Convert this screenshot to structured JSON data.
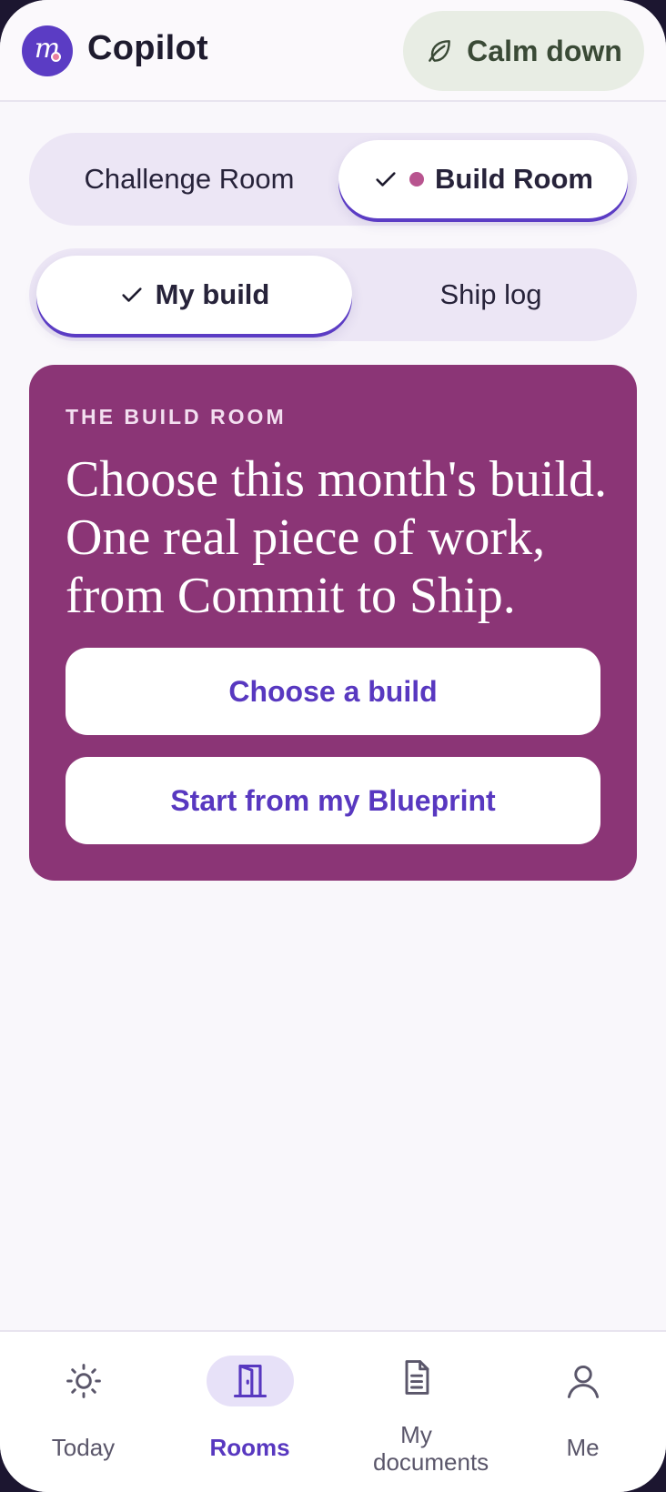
{
  "header": {
    "logo_letter": "m",
    "app_title": "Copilot",
    "calm_button_label": "Calm down"
  },
  "room_switch": {
    "options": [
      {
        "label": "Challenge Room",
        "selected": false
      },
      {
        "label": "Build Room",
        "selected": true
      }
    ]
  },
  "build_tabs": {
    "options": [
      {
        "label": "My build",
        "selected": true
      },
      {
        "label": "Ship log",
        "selected": false
      }
    ]
  },
  "card": {
    "eyebrow": "THE BUILD ROOM",
    "headline": "Choose this month's build. One real piece of work, from Commit to Ship.",
    "primary_button": "Choose a build",
    "secondary_button": "Start from my Blueprint",
    "background_color": "#8b3576"
  },
  "bottom_nav": {
    "items": [
      {
        "label": "Today",
        "icon": "sun-icon",
        "active": false
      },
      {
        "label": "Rooms",
        "icon": "door-icon",
        "active": true
      },
      {
        "label": "My documents",
        "icon": "document-icon",
        "active": false
      },
      {
        "label": "Me",
        "icon": "person-icon",
        "active": false
      }
    ]
  },
  "colors": {
    "accent": "#5838c0",
    "pink_dot": "#b8548f",
    "calm_bg": "#e8ede4"
  }
}
